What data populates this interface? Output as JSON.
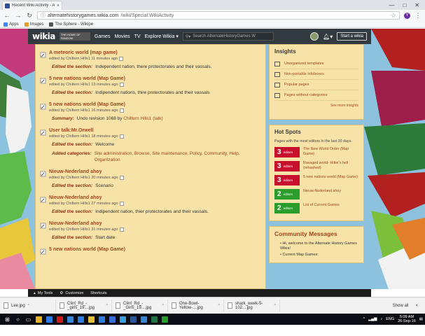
{
  "browser": {
    "tab_title": "Recent Wiki Activity - Alte",
    "tab_close": "×",
    "win_controls": [
      "—",
      "□",
      "✕"
    ],
    "url_host": "alternatehistorygames.wikia.com",
    "url_path": "/wiki/Special:WikiActivity",
    "bookmarks": [
      {
        "label": "Apps",
        "icon": "apps-grid-icon",
        "color": "#4285f4"
      },
      {
        "label": "Images",
        "icon": "images-icon",
        "color": "#e0a030"
      },
      {
        "label": "The Sphere - Wikipe",
        "icon": "wikipedia-icon",
        "color": "#555555"
      }
    ]
  },
  "wikia_header": {
    "logo": "wikia",
    "tagline": "THE HOME OF FANDOM",
    "nav": [
      "Games",
      "Movies",
      "TV",
      "Explore Wikia ▾"
    ],
    "search_placeholder": "Search AlternateHistoryGames W",
    "start_label": "Start a wikia"
  },
  "activity": [
    {
      "title": "A meteoric world (map game)",
      "meta": "edited by Chiltern Hills1 11 minutes ago",
      "rows": [
        {
          "label": "Edited the section:",
          "value": "Independent nation, there protectorates and their vassals."
        }
      ]
    },
    {
      "title": "5 new nations world (Map Game)",
      "meta": "edited by Chiltern Hills1 13 minutes ago",
      "rows": [
        {
          "label": "Edited the section:",
          "value": "Indipendent nations, thire protectorates and their vassals"
        }
      ]
    },
    {
      "title": "5 new nations world (Map Game)",
      "meta": "edited by Chiltern Hills1 16 minutes ago",
      "rows": [
        {
          "label": "Summary:",
          "value": "Undo revision 1068 by",
          "link": "Chiltern Hills1",
          "extra": "(talk)"
        }
      ]
    },
    {
      "title": "User talk:Mr.Orwell",
      "meta": "edited by Chiltern Hills1 18 minutes ago",
      "rows": [
        {
          "label": "Edited the section:",
          "value": "Welcome"
        },
        {
          "label": "Added categories:",
          "value": "Site administration, Browse, Site maintenance, Policy, Community, Help, Organization",
          "is_link": true
        }
      ]
    },
    {
      "title": "Nieuw-Nederland ahoy",
      "meta": "edited by Chiltern Hills1 20 minutes ago",
      "rows": [
        {
          "label": "Edited the section:",
          "value": "Scenario"
        }
      ]
    },
    {
      "title": "Nieuw-Nederland ahoy",
      "meta": "edited by Chiltern Hills1 27 minutes ago",
      "rows": [
        {
          "label": "Edited the section:",
          "value": "Indipendent nation, thier protectorates and their vassals."
        }
      ]
    },
    {
      "title": "Nieuw-Nederland ahoy",
      "meta": "edited by Chiltern Hills1 31 minutes ago",
      "rows": [
        {
          "label": "Edited the section:",
          "value": "Start date"
        }
      ]
    },
    {
      "title": "5 new nations world (Map Game)",
      "meta": "",
      "rows": []
    }
  ],
  "insights": {
    "heading": "Insights",
    "items": [
      "Unorganized templates",
      "Non-portable infoboxes",
      "Popular pages",
      "Pages without categories"
    ],
    "see_more": "See more insights"
  },
  "hot_spots": {
    "heading": "Hot Spots",
    "description": "Pages with the most editors in the last 30 days.",
    "editors_label": "editors",
    "items": [
      {
        "count": "3",
        "title": "The New World Order (Map Game)",
        "color": "#c8102e"
      },
      {
        "count": "3",
        "title": "Ravaged world- Hitler's hell (rehashed)",
        "color": "#c8102e"
      },
      {
        "count": "3",
        "title": "5 new nations world (Map Game)",
        "color": "#c8102e"
      },
      {
        "count": "2",
        "title": "Nieuw-Nederland ahoy",
        "color": "#2a9d2a"
      },
      {
        "count": "2",
        "title": "List of Current Games",
        "color": "#2a9d2a"
      }
    ]
  },
  "community": {
    "heading": "Community Messages",
    "items": [
      "Hi, welcome to the Alternate History Games Wikia!",
      "Current Map Games:"
    ]
  },
  "toolbar": {
    "items": [
      "My Tools",
      "Customize",
      "Shortcuts"
    ]
  },
  "downloads": {
    "items": [
      "Lee.jpg",
      "Clint_Rd_-_girls_19....jpg",
      "Clint_Rd_-_Girls_19....jpg",
      "One-Bowl-Yellow-....jpg",
      "shark_week-5-102....jpg"
    ],
    "caret": "^",
    "show_all": "Show all",
    "close": "×"
  },
  "taskbar": {
    "lang": "ENG",
    "time": "5:09 AM",
    "date": "26-Sep-16",
    "apps": [
      {
        "name": "chrome",
        "color": "#e8b423"
      },
      {
        "name": "edge",
        "color": "#2d7de0"
      },
      {
        "name": "opera",
        "color": "#cc1b1b"
      },
      {
        "name": "store",
        "color": "#3a86d6"
      },
      {
        "name": "mail",
        "color": "#2d7de0"
      },
      {
        "name": "folder",
        "color": "#e8c040"
      },
      {
        "name": "media",
        "color": "#2d7de0"
      },
      {
        "name": "photos",
        "color": "#3a6fd6"
      },
      {
        "name": "ie",
        "color": "#3a9ee0"
      },
      {
        "name": "word",
        "color": "#2b5797"
      },
      {
        "name": "bluestack",
        "color": "#3a86d6"
      },
      {
        "name": "excel",
        "color": "#217346"
      },
      {
        "name": "pen",
        "color": "#2a9d2a"
      }
    ]
  }
}
